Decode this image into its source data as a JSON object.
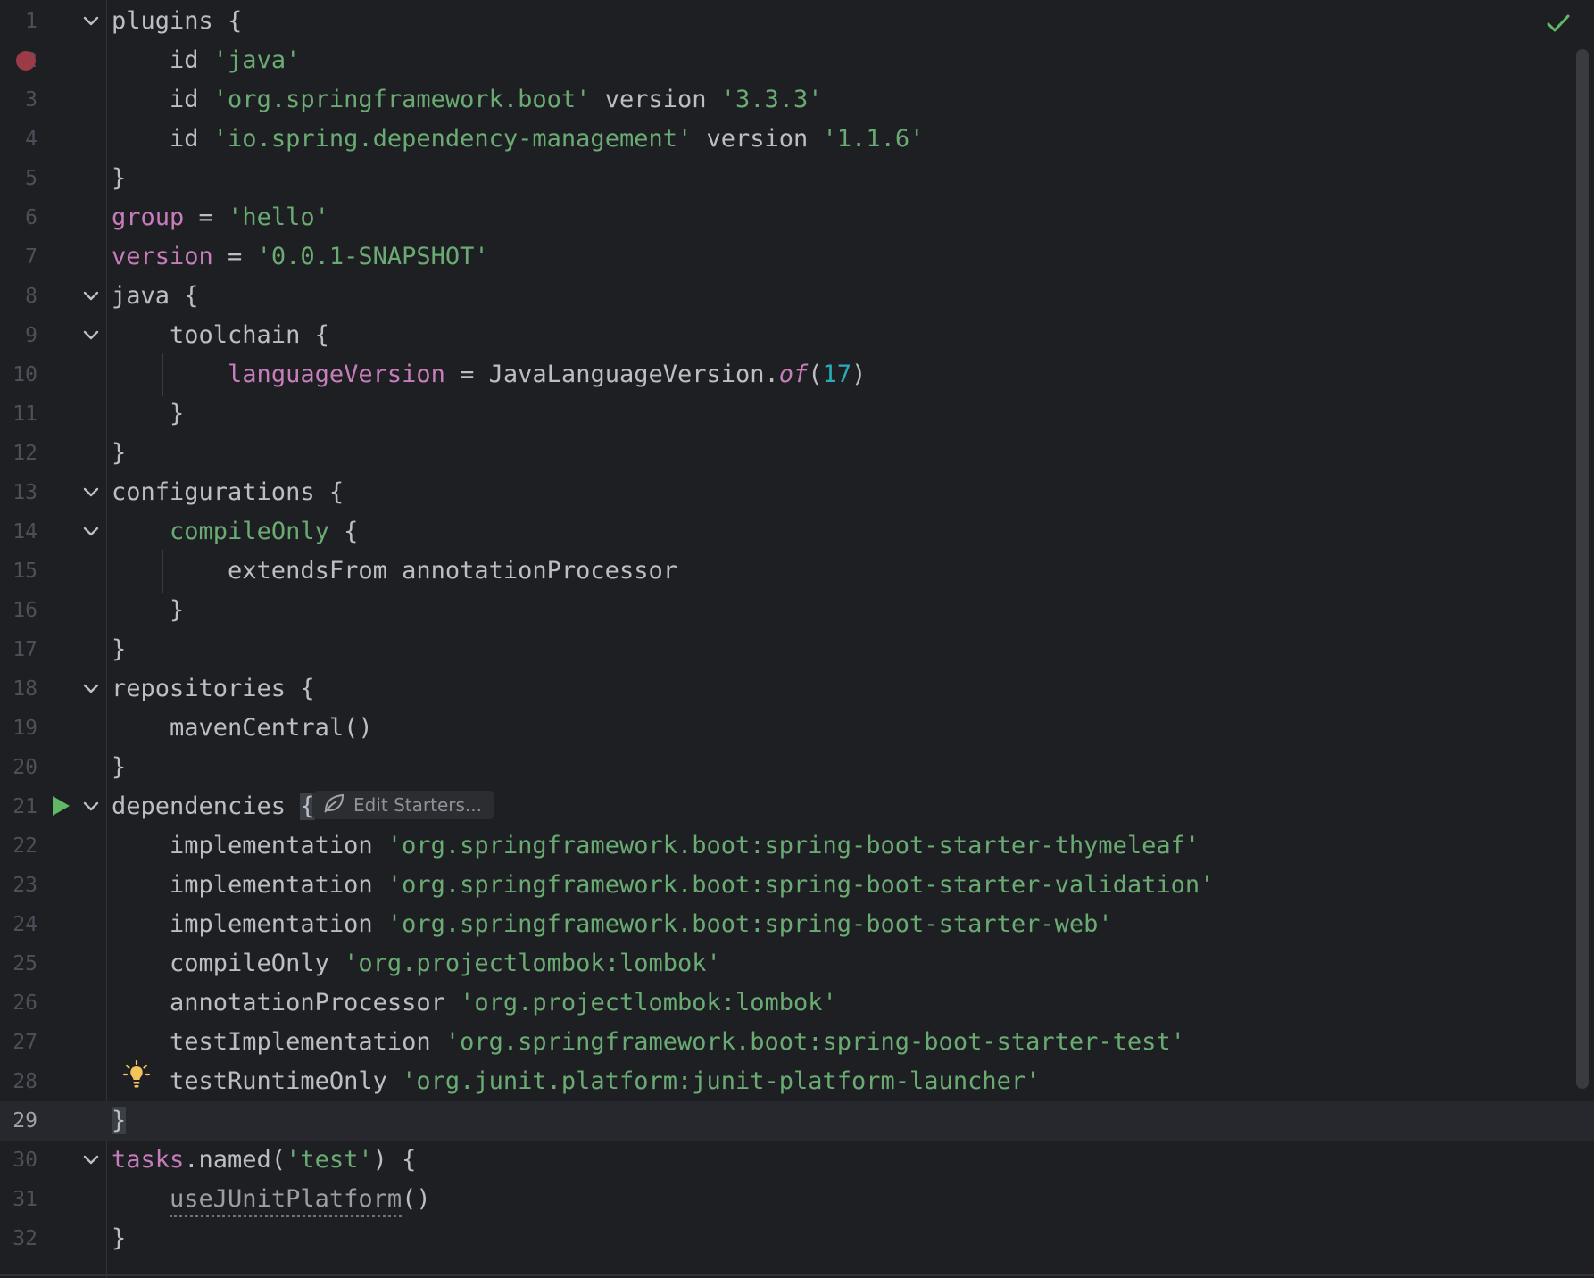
{
  "status": {
    "inspections_ok_icon": "check-icon"
  },
  "inlay": {
    "edit_starters_label": "Edit Starters..."
  },
  "lines": [
    {
      "num": "1"
    },
    {
      "num": "2"
    },
    {
      "num": "3"
    },
    {
      "num": "4"
    },
    {
      "num": "5"
    },
    {
      "num": "6"
    },
    {
      "num": "7"
    },
    {
      "num": "8"
    },
    {
      "num": "9"
    },
    {
      "num": "10"
    },
    {
      "num": "11"
    },
    {
      "num": "12"
    },
    {
      "num": "13"
    },
    {
      "num": "14"
    },
    {
      "num": "15"
    },
    {
      "num": "16"
    },
    {
      "num": "17"
    },
    {
      "num": "18"
    },
    {
      "num": "19"
    },
    {
      "num": "20"
    },
    {
      "num": "21"
    },
    {
      "num": "22"
    },
    {
      "num": "23"
    },
    {
      "num": "24"
    },
    {
      "num": "25"
    },
    {
      "num": "26"
    },
    {
      "num": "27"
    },
    {
      "num": "28"
    },
    {
      "num": "29"
    },
    {
      "num": "30"
    },
    {
      "num": "31"
    },
    {
      "num": "32"
    }
  ],
  "code": {
    "l1": {
      "a": "plugins {"
    },
    "l2": {
      "a": "    id ",
      "s1": "'java'"
    },
    "l3": {
      "a": "    id ",
      "s1": "'org.springframework.boot'",
      "b": " version ",
      "s2": "'3.3.3'"
    },
    "l4": {
      "a": "    id ",
      "s1": "'io.spring.dependency-management'",
      "b": " version ",
      "s2": "'1.1.6'"
    },
    "l5": {
      "a": "}"
    },
    "l6": {
      "p": "group",
      "a": " = ",
      "s1": "'hello'"
    },
    "l7": {
      "p": "version",
      "a": " = ",
      "s1": "'0.0.1-SNAPSHOT'"
    },
    "l8": {
      "a": "java {"
    },
    "l9": {
      "a": "    toolchain {"
    },
    "l10": {
      "a": "        ",
      "p": "languageVersion",
      "b": " = JavaLanguageVersion.",
      "i": "of",
      "c": "(",
      "n": "17",
      "d": ")"
    },
    "l11": {
      "a": "    }"
    },
    "l12": {
      "a": "}"
    },
    "l13": {
      "a": "configurations {"
    },
    "l14": {
      "a": "    ",
      "g": "compileOnly",
      "b": " {"
    },
    "l15": {
      "a": "        extendsFrom annotationProcessor"
    },
    "l16": {
      "a": "    }"
    },
    "l17": {
      "a": "}"
    },
    "l18": {
      "a": "repositories {"
    },
    "l19": {
      "a": "    mavenCentral()"
    },
    "l20": {
      "a": "}"
    },
    "l21": {
      "a": "dependencies ",
      "b": "{"
    },
    "l22": {
      "a": "    implementation ",
      "s1": "'org.springframework.boot:spring-boot-starter-thymeleaf'"
    },
    "l23": {
      "a": "    implementation ",
      "s1": "'org.springframework.boot:spring-boot-starter-validation'"
    },
    "l24": {
      "a": "    implementation ",
      "s1": "'org.springframework.boot:spring-boot-starter-web'"
    },
    "l25": {
      "a": "    compileOnly ",
      "s1": "'org.projectlombok:lombok'"
    },
    "l26": {
      "a": "    annotationProcessor ",
      "s1": "'org.projectlombok:lombok'"
    },
    "l27": {
      "a": "    testImplementation ",
      "s1": "'org.springframework.boot:spring-boot-starter-test'"
    },
    "l28": {
      "a": "    testRuntimeOnly ",
      "s1": "'org.junit.platform:junit-platform-launcher'"
    },
    "l29": {
      "a": "}"
    },
    "l30": {
      "p": "tasks",
      "a": ".named(",
      "s1": "'test'",
      "b": ") {"
    },
    "l31": {
      "a": "    ",
      "u": "useJUnitPlatform",
      "b": "()"
    },
    "l32": {
      "a": "}"
    }
  },
  "colors": {
    "background": "#1e1f22",
    "text": "#bcbec4",
    "string": "#6aab73",
    "property": "#c77dbb",
    "number": "#2aacb8",
    "line_number": "#4b5059",
    "breakpoint": "#9a3b47",
    "run": "#5fb865",
    "bulb": "#f2c55c"
  }
}
